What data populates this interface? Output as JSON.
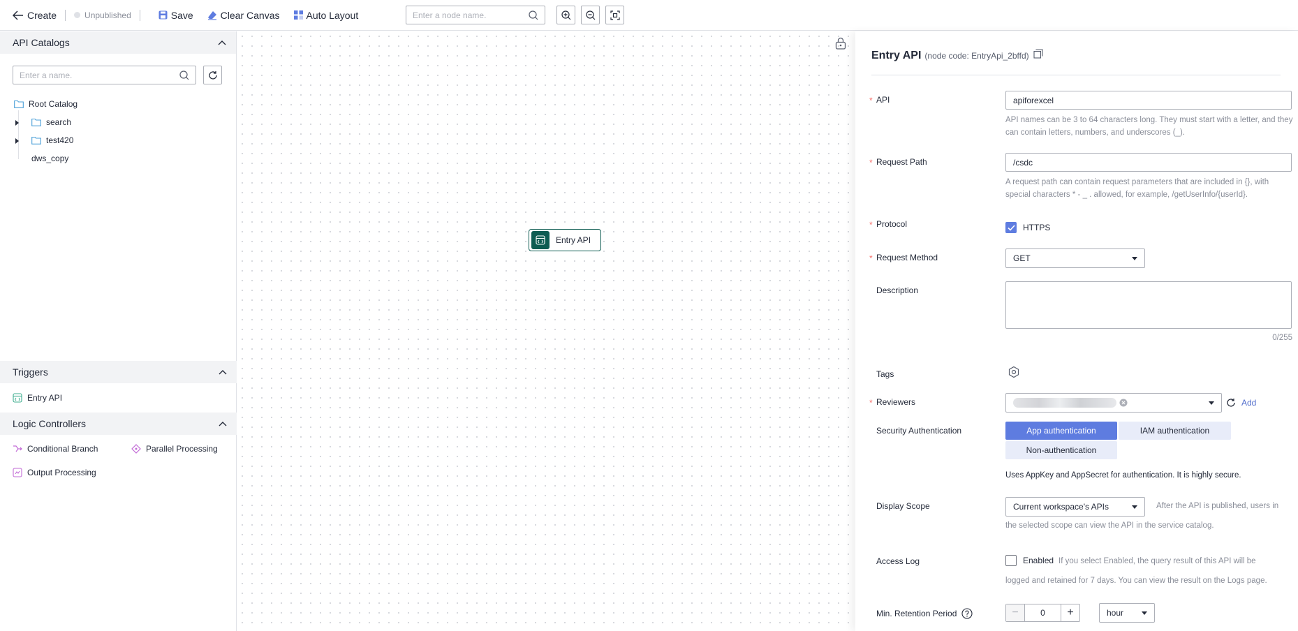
{
  "toolbar": {
    "back_label": "Create",
    "status": "Unpublished",
    "save_label": "Save",
    "clear_label": "Clear Canvas",
    "layout_label": "Auto Layout",
    "node_search_placeholder": "Enter a node name."
  },
  "catalogs": {
    "title": "API Catalogs",
    "search_placeholder": "Enter a name.",
    "root": "Root Catalog",
    "items": [
      "search",
      "test420",
      "dws_copy"
    ]
  },
  "triggers": {
    "title": "Triggers",
    "items": [
      "Entry API"
    ]
  },
  "logic": {
    "title": "Logic Controllers",
    "items": [
      "Conditional Branch",
      "Parallel Processing",
      "Output Processing"
    ]
  },
  "canvas": {
    "node_label": "Entry API"
  },
  "panel": {
    "title": "Entry API",
    "node_code": "(node code: EntryApi_2bffd)",
    "api_label": "API",
    "api_value": "apiforexcel",
    "api_hint": "API names can be 3 to 64 characters long. They must start with a letter, and they can contain letters, numbers, and underscores (_).",
    "path_label": "Request Path",
    "path_value": "/csdc",
    "path_hint": "A request path can contain request parameters that are included in {}, with special characters * - _ . allowed, for example, /getUserInfo/{userId}.",
    "protocol_label": "Protocol",
    "protocol_value": "HTTPS",
    "method_label": "Request Method",
    "method_value": "GET",
    "description_label": "Description",
    "description_counter": "0/255",
    "tags_label": "Tags",
    "reviewers_label": "Reviewers",
    "reviewers_add": "Add",
    "security_label": "Security Authentication",
    "auth_options": [
      "App authentication",
      "IAM authentication",
      "Non-authentication"
    ],
    "auth_hint": "Uses AppKey and AppSecret for authentication. It is highly secure.",
    "scope_label": "Display Scope",
    "scope_value": "Current workspace's APIs",
    "scope_hint_1": "After the API is published, users in",
    "scope_hint_2": "the selected scope can view the API in the service catalog.",
    "log_label": "Access Log",
    "log_option": "Enabled",
    "log_hint_1": "If you select Enabled, the query result of this API will be",
    "log_hint_2": "logged and retained for 7 days. You can view the result on the Logs page.",
    "retention_label": "Min. Retention Period",
    "retention_value": "0",
    "retention_unit": "hour"
  },
  "colors": {
    "primary": "#5e7ce0",
    "node_accent": "#0e5c52",
    "required": "#f66f6a",
    "logic_icon": "#c26bd6",
    "trigger_icon": "#3fae8f"
  }
}
